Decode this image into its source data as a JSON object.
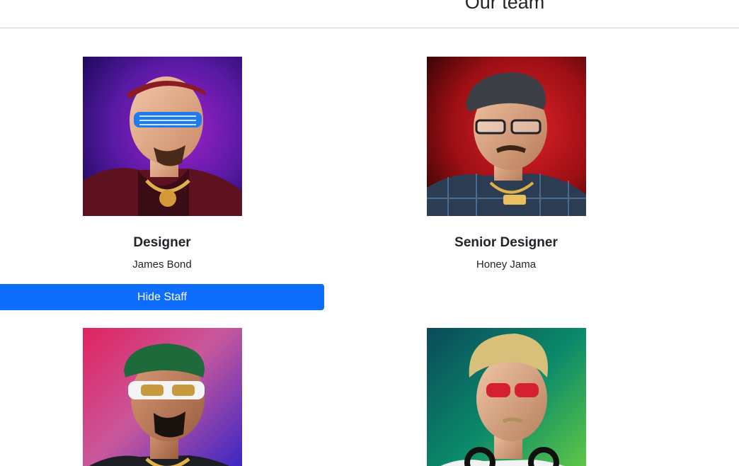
{
  "header": {
    "title": "Our team"
  },
  "staff": [
    {
      "role": "Designer",
      "name": "James Bond"
    },
    {
      "role": "Senior Designer",
      "name": "Honey Jama"
    }
  ],
  "actions": {
    "hide_staff_label": "Hide Staff"
  },
  "colors": {
    "primary": "#0d6efd"
  }
}
